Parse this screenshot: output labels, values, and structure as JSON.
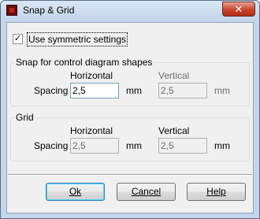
{
  "window": {
    "title": "Snap & Grid",
    "close_glyph": "✕",
    "app_icon": "snap-grid-app-icon"
  },
  "symmetric": {
    "label": "Use symmetric settings",
    "checked": true,
    "check_glyph": "✓"
  },
  "snap_group": {
    "title": "Snap for control diagram shapes",
    "row_label": "Spacing",
    "horizontal_label": "Horizontal",
    "vertical_label": "Vertical",
    "horizontal_value": "2,5",
    "vertical_value": "2,5",
    "unit": "mm"
  },
  "grid_group": {
    "title": "Grid",
    "row_label": "Spacing",
    "horizontal_label": "Horizontal",
    "vertical_label": "Vertical",
    "horizontal_value": "2,5",
    "vertical_value": "2,5",
    "unit": "mm"
  },
  "buttons": {
    "ok": "Ok",
    "cancel": "Cancel",
    "help": "Help"
  },
  "colors": {
    "close_button": "#c7432b",
    "focus_border": "#3c7fb1"
  }
}
